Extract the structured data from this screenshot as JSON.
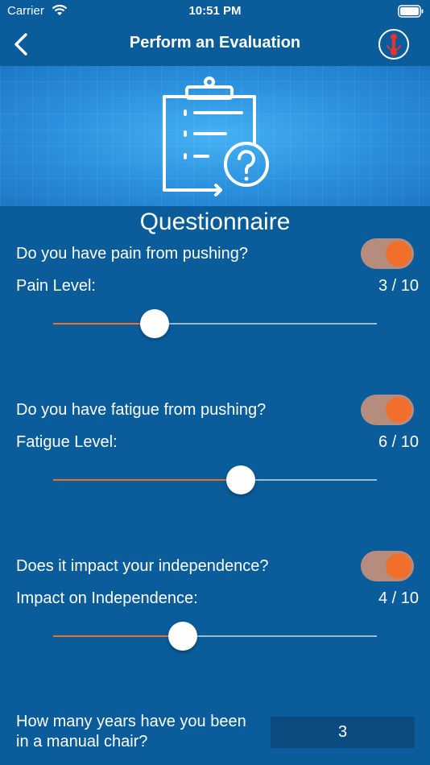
{
  "status": {
    "carrier": "Carrier",
    "time": "10:51 PM"
  },
  "nav": {
    "title": "Perform an Evaluation"
  },
  "section_title": "Questionnaire",
  "questions": [
    {
      "question": "Do you have pain from pushing?",
      "toggle_on": true,
      "level_label": "Pain Level:",
      "value_text": "3 / 10",
      "value": 3,
      "max": 10
    },
    {
      "question": "Do you have fatigue from pushing?",
      "toggle_on": true,
      "level_label": "Fatigue Level:",
      "value_text": "6 / 10",
      "value": 6,
      "max": 10
    },
    {
      "question": "Does it impact your independence?",
      "toggle_on": true,
      "level_label": "Impact on Independence:",
      "value_text": "4 / 10",
      "value": 4,
      "max": 10
    }
  ],
  "years": {
    "label": "How many years have you been in a manual chair?",
    "value": "3"
  },
  "colors": {
    "background": "#0a5c9a",
    "accent": "#f26e2b",
    "input_bg": "#0c4b80"
  },
  "icons": {
    "back": "chevron-left-icon",
    "action": "pin-icon",
    "banner": "clipboard-question-icon"
  }
}
